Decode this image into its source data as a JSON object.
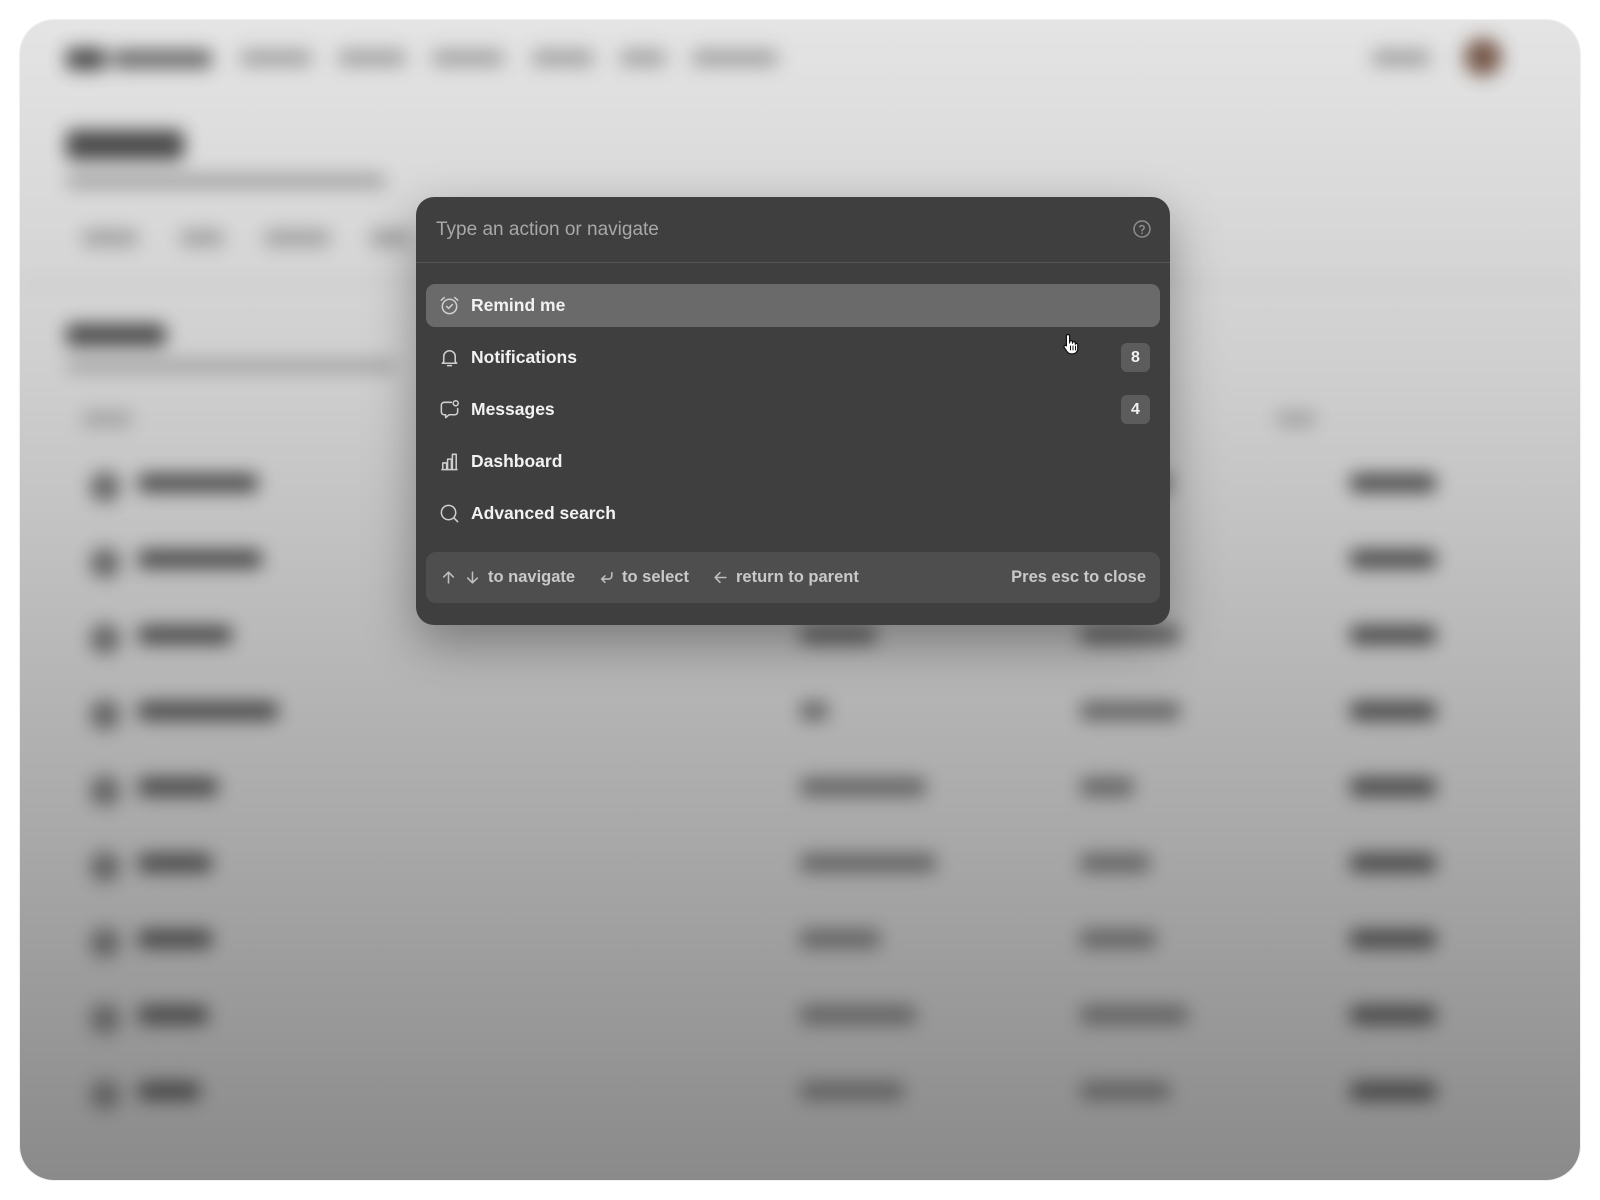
{
  "command_palette": {
    "search": {
      "placeholder": "Type an action or navigate",
      "value": ""
    },
    "items": [
      {
        "label": "Remind me",
        "icon": "alarm-clock-icon",
        "badge": null,
        "active": true
      },
      {
        "label": "Notifications",
        "icon": "bell-icon",
        "badge": "8",
        "active": false
      },
      {
        "label": "Messages",
        "icon": "chat-bubble-icon",
        "badge": "4",
        "active": false
      },
      {
        "label": "Dashboard",
        "icon": "bar-chart-icon",
        "badge": null,
        "active": false
      },
      {
        "label": "Advanced search",
        "icon": "search-icon",
        "badge": null,
        "active": false
      }
    ],
    "footer": {
      "navigate_hint": "to navigate",
      "select_hint": "to select",
      "parent_hint": "return to parent",
      "close_hint": "Pres esc to close"
    }
  },
  "colors": {
    "palette_bg": "#3f3f3f",
    "active_item_bg": "#6a6a6a",
    "footer_bg": "#4e4e4e",
    "text": "#f2f2f2"
  }
}
